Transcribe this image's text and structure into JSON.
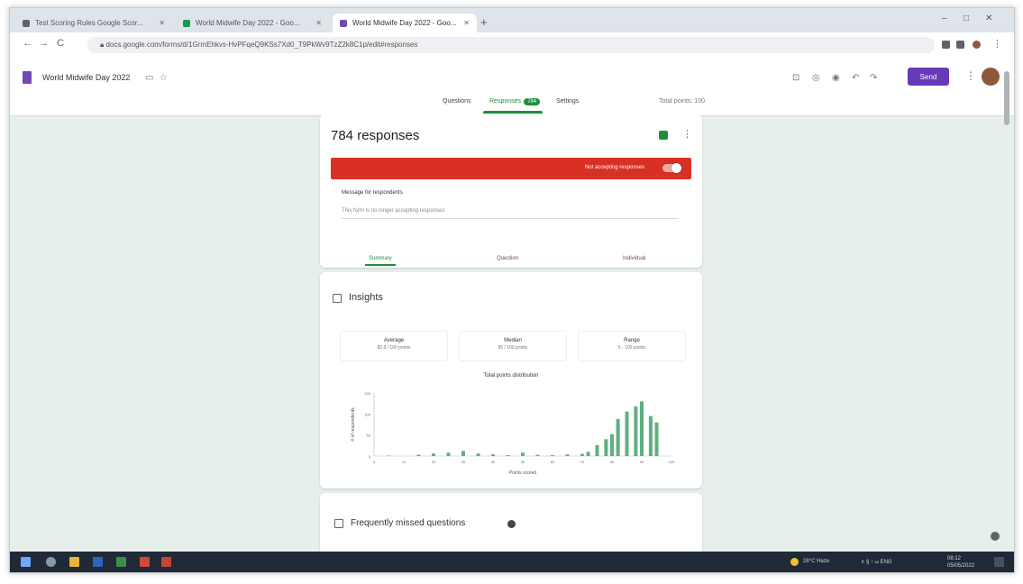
{
  "browser": {
    "tabs": [
      {
        "title": "Test Scoring Rules Google Scor...",
        "favicon_color": "#5f6368",
        "active": false
      },
      {
        "title": "World Midwife Day 2022 - Goo...",
        "favicon_color": "#0f9d58",
        "active": false
      },
      {
        "title": "World Midwife Day 2022 - Goo...",
        "favicon_color": "#7248b9",
        "active": true
      }
    ],
    "new_tab_symbol": "+",
    "window_controls": [
      "–",
      "□",
      "✕"
    ],
    "nav": {
      "back": "←",
      "forward": "→",
      "reload": "C"
    },
    "url": "docs.google.com/forms/d/1GrmEhkvs-HvPFqeQ9KSs7Xd0_T9PkWv9TzZ2k8C1p/edit#responses"
  },
  "forms": {
    "title": "World Midwife Day 2022",
    "send_label": "Send",
    "nav_tabs": [
      "Questions",
      "Responses",
      "Settings"
    ],
    "response_badge": "784",
    "total_points": "Total points: 100"
  },
  "summary_card": {
    "count_text": "784 responses",
    "accepting_label": "Not accepting responses",
    "message_label": "Message for respondents",
    "message_placeholder": "This form is no longer accepting responses",
    "subtabs": [
      "Summary",
      "Question",
      "Individual"
    ]
  },
  "insights": {
    "title": "Insights",
    "stats": [
      {
        "label": "Average",
        "value": "82.8 / 100 points"
      },
      {
        "label": "Median",
        "value": "85 / 100 points"
      },
      {
        "label": "Range",
        "value": "5 - 100 points"
      }
    ]
  },
  "chart_data": {
    "type": "bar",
    "title": "Total points distribution",
    "xlabel": "Points scored",
    "ylabel": "# of respondents",
    "ylim": [
      0,
      150
    ],
    "yticks": [
      0,
      50,
      100,
      150
    ],
    "xticks": [
      "0",
      "10",
      "20",
      "30",
      "40",
      "50",
      "60",
      "70",
      "80",
      "90",
      "100"
    ],
    "x": [
      5,
      15,
      20,
      25,
      30,
      35,
      40,
      45,
      50,
      55,
      60,
      65,
      70,
      72,
      75,
      78,
      80,
      82,
      85,
      88,
      90,
      93,
      95,
      98
    ],
    "values": [
      1,
      3,
      6,
      8,
      12,
      6,
      4,
      2,
      8,
      3,
      2,
      4,
      5,
      10,
      26,
      40,
      52,
      88,
      106,
      118,
      130,
      95,
      80,
      0
    ],
    "color": "#5fb07f",
    "grid": false
  },
  "missed": {
    "title": "Frequently missed questions"
  },
  "taskbar": {
    "weather": "28°C Haze",
    "tray": "∧ § ↑ ⟒ ENG",
    "time": "08:12",
    "date": "05/05/2022"
  }
}
